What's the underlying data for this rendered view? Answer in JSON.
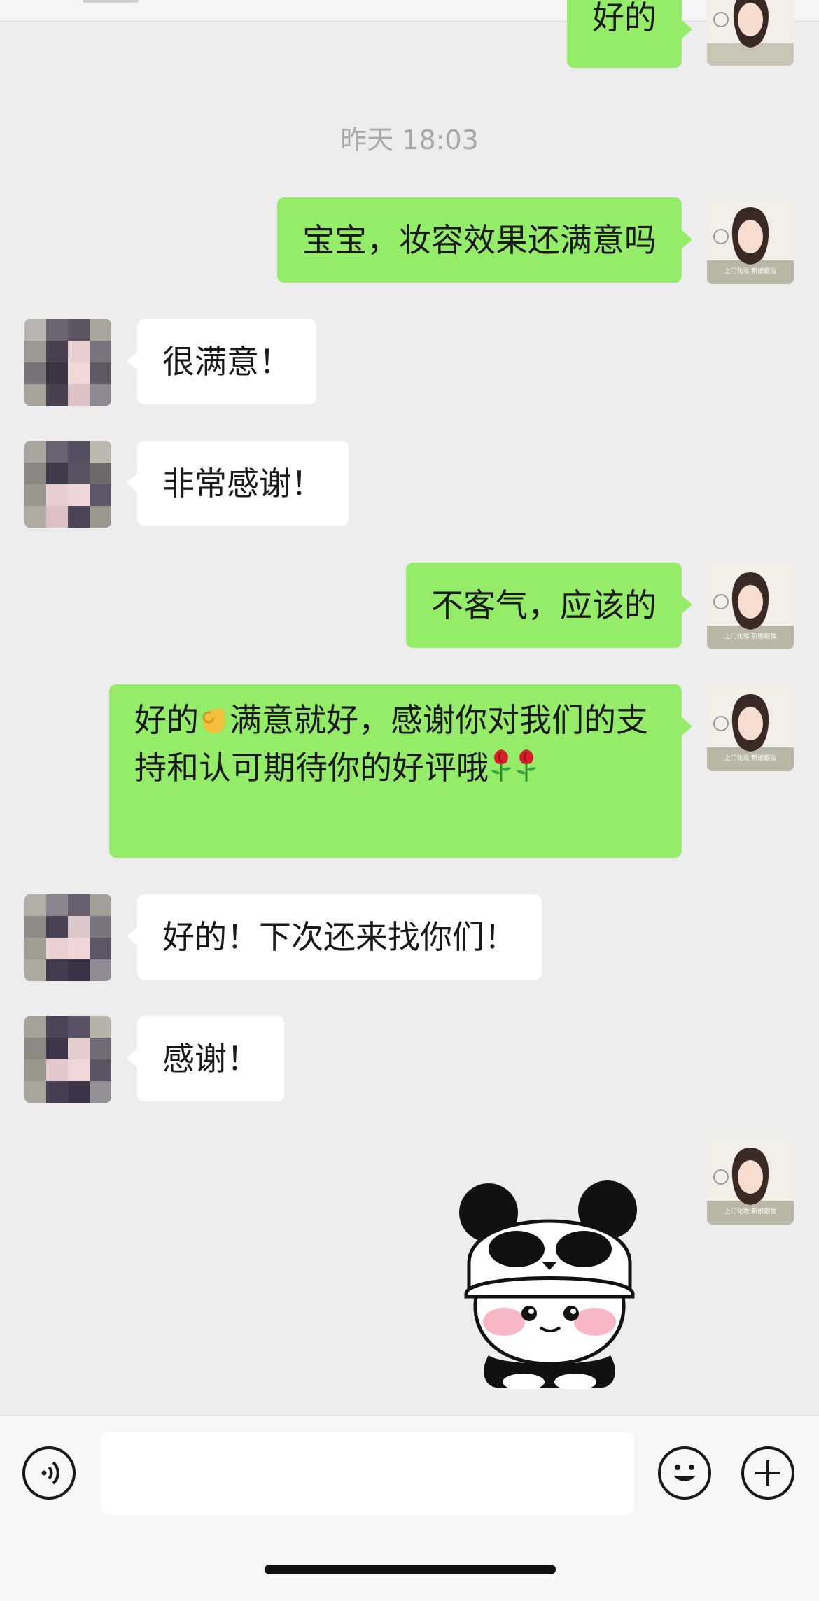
{
  "chat": {
    "timestamp": "昨天 18:03",
    "messages": [
      {
        "from": "me",
        "text": "好的"
      },
      {
        "from": "me",
        "text": "宝宝，妆容效果还满意吗"
      },
      {
        "from": "other",
        "text": "很满意！"
      },
      {
        "from": "other",
        "text": "非常感谢！"
      },
      {
        "from": "me",
        "text": "不客气，应该的"
      },
      {
        "from": "me",
        "text_part1": "好的",
        "emoji_ok": "👌",
        "text_part2": "满意就好，感谢你对我们的支持和认可期待你的好评哦",
        "emoji_rose": "🌹"
      },
      {
        "from": "other",
        "text": "好的！下次还来找你们！"
      },
      {
        "from": "other",
        "text": "感谢！"
      },
      {
        "from": "me",
        "sticker": "panda-sticker"
      }
    ]
  },
  "avatar_me": {
    "caption": "上门化妆 新娘跟妆"
  },
  "input_bar": {
    "voice_icon": "voice-icon",
    "emoji_icon": "smiley-icon",
    "more_icon": "plus-icon",
    "input_value": ""
  },
  "colors": {
    "background": "#ededed",
    "my_bubble": "#95ec69",
    "other_bubble": "#ffffff",
    "timestamp": "#a8a8a8"
  }
}
